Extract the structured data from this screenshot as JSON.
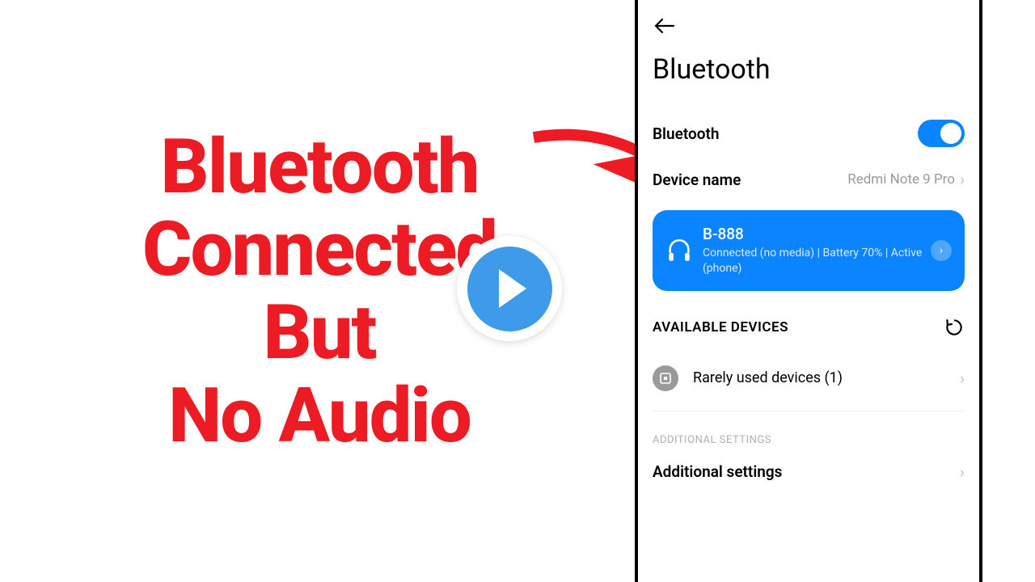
{
  "headline": {
    "line1": "Bluetooth",
    "line2": "Connected",
    "line3": "But",
    "line4": "No Audio"
  },
  "phone": {
    "title": "Bluetooth",
    "toggle_label": "Bluetooth",
    "device_name_label": "Device name",
    "device_name_value": "Redmi Note 9 Pro",
    "connected": {
      "name": "B-888",
      "status": "Connected (no media) | Battery 70% | Active (phone)"
    },
    "available_header": "AVAILABLE DEVICES",
    "rarely_used": "Rarely used devices (1)",
    "additional_header": "ADDITIONAL SETTINGS",
    "additional_label": "Additional settings"
  }
}
